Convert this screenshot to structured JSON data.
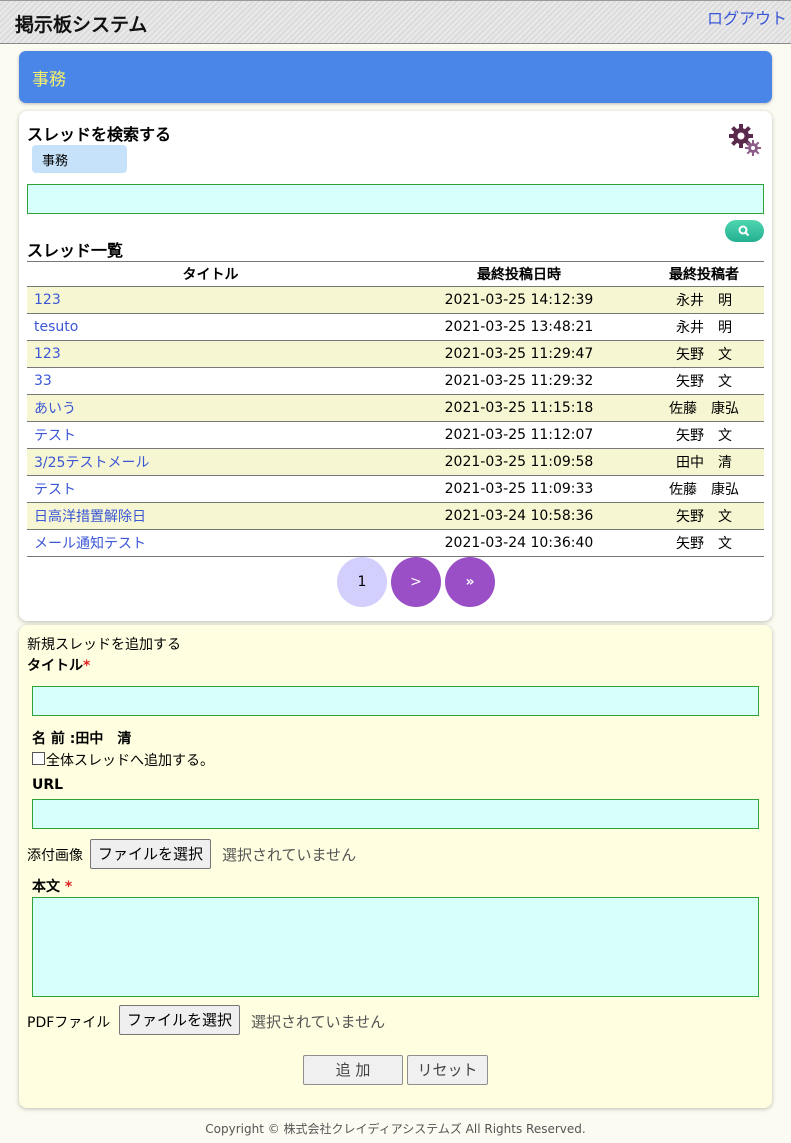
{
  "header": {
    "title": "掲示板システム",
    "logout": "ログアウト"
  },
  "banner": {
    "category": "事務"
  },
  "search": {
    "title": "スレッドを検索する",
    "category_chip": "事務",
    "input_value": ""
  },
  "list": {
    "title": "スレッド一覧",
    "columns": [
      "タイトル",
      "最終投稿日時",
      "最終投稿者"
    ],
    "rows": [
      {
        "title": "123",
        "date": "2021-03-25 14:12:39",
        "author": "永井　明"
      },
      {
        "title": "tesuto",
        "date": "2021-03-25 13:48:21",
        "author": "永井　明"
      },
      {
        "title": "123",
        "date": "2021-03-25 11:29:47",
        "author": "矢野　文"
      },
      {
        "title": "33",
        "date": "2021-03-25 11:29:32",
        "author": "矢野　文"
      },
      {
        "title": "あいう",
        "date": "2021-03-25 11:15:18",
        "author": "佐藤　康弘"
      },
      {
        "title": "テスト",
        "date": "2021-03-25 11:12:07",
        "author": "矢野　文"
      },
      {
        "title": "3/25テストメール",
        "date": "2021-03-25 11:09:58",
        "author": "田中　清"
      },
      {
        "title": "テスト",
        "date": "2021-03-25 11:09:33",
        "author": "佐藤　康弘"
      },
      {
        "title": "日高洋措置解除日",
        "date": "2021-03-24 10:58:36",
        "author": "矢野　文"
      },
      {
        "title": "メール通知テスト",
        "date": "2021-03-24 10:36:40",
        "author": "矢野　文"
      }
    ]
  },
  "pager": {
    "current": "1",
    "next": ">",
    "last": "»"
  },
  "new_thread": {
    "heading": "新規スレッドを追加する",
    "title_label": "タイトル",
    "required_mark": "*",
    "name_label": "名 前 :田中　清",
    "all_threads_checkbox": "全体スレッドへ追加する。",
    "url_label": "URL",
    "image_label": "添付画像",
    "file_button": "ファイルを選択",
    "no_file": "選択されていません",
    "body_label": "本文",
    "pdf_label": "PDFファイル",
    "submit": "追 加",
    "reset": "リセット"
  },
  "footer": "Copyright © 株式会社クレイディアシステムズ All Rights Reserved.",
  "colors": {
    "banner": "#4a86e8",
    "banner_text": "#f7f06a",
    "link": "#3b57d6",
    "input_bg": "#d7fffb",
    "row_alt": "#f6f6d2",
    "pager_active": "#d3cffd",
    "pager_btn": "#9a4fc6"
  },
  "icons": {
    "settings": "gear-icon",
    "search": "search-icon"
  }
}
